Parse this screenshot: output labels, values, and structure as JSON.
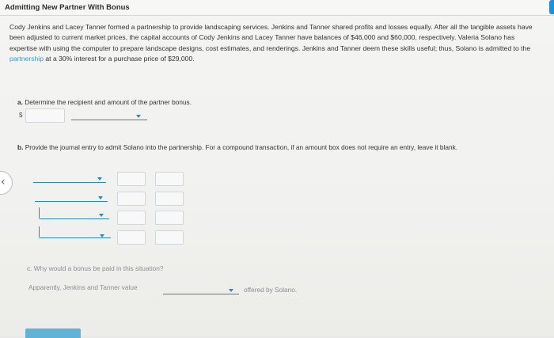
{
  "title": "Admitting New Partner With Bonus",
  "problem": {
    "before": "Cody Jenkins and Lacey Tanner formed a partnership to provide landscaping services. Jenkins and Tanner shared profits and losses equally. After all the tangible assets have been adjusted to current market prices, the capital accounts of Cody Jenkins and Lacey Tanner have balances of $46,000 and $60,000, respectively. Valeria Solano has expertise with using the computer to prepare landscape designs, cost estimates, and renderings. Jenkins and Tanner deem these skills useful; thus, Solano is admitted to the ",
    "link": "partnership",
    "after": " at a 30% interest for a purchase price of $29,000."
  },
  "part_a": {
    "letter": "a.",
    "text": "Determine the recipient and amount of the partner bonus.",
    "currency": "$"
  },
  "part_b": {
    "letter": "b.",
    "text": "Provide the journal entry to admit Solano into the partnership. For a compound transaction, if an amount box does not require an entry, leave it blank."
  },
  "part_c": {
    "letter": "c.",
    "text": "Why would a bonus be paid in this situation?",
    "prefix": "Apparently, Jenkins and Tanner value",
    "suffix": "offered by Solano."
  },
  "colors": {
    "accent": "#2e86c1",
    "link": "#3b97d3",
    "button": "#5fb3d9"
  },
  "icons": {
    "side_nav": "chevron-left-icon",
    "dropdown": "caret-down-icon"
  }
}
